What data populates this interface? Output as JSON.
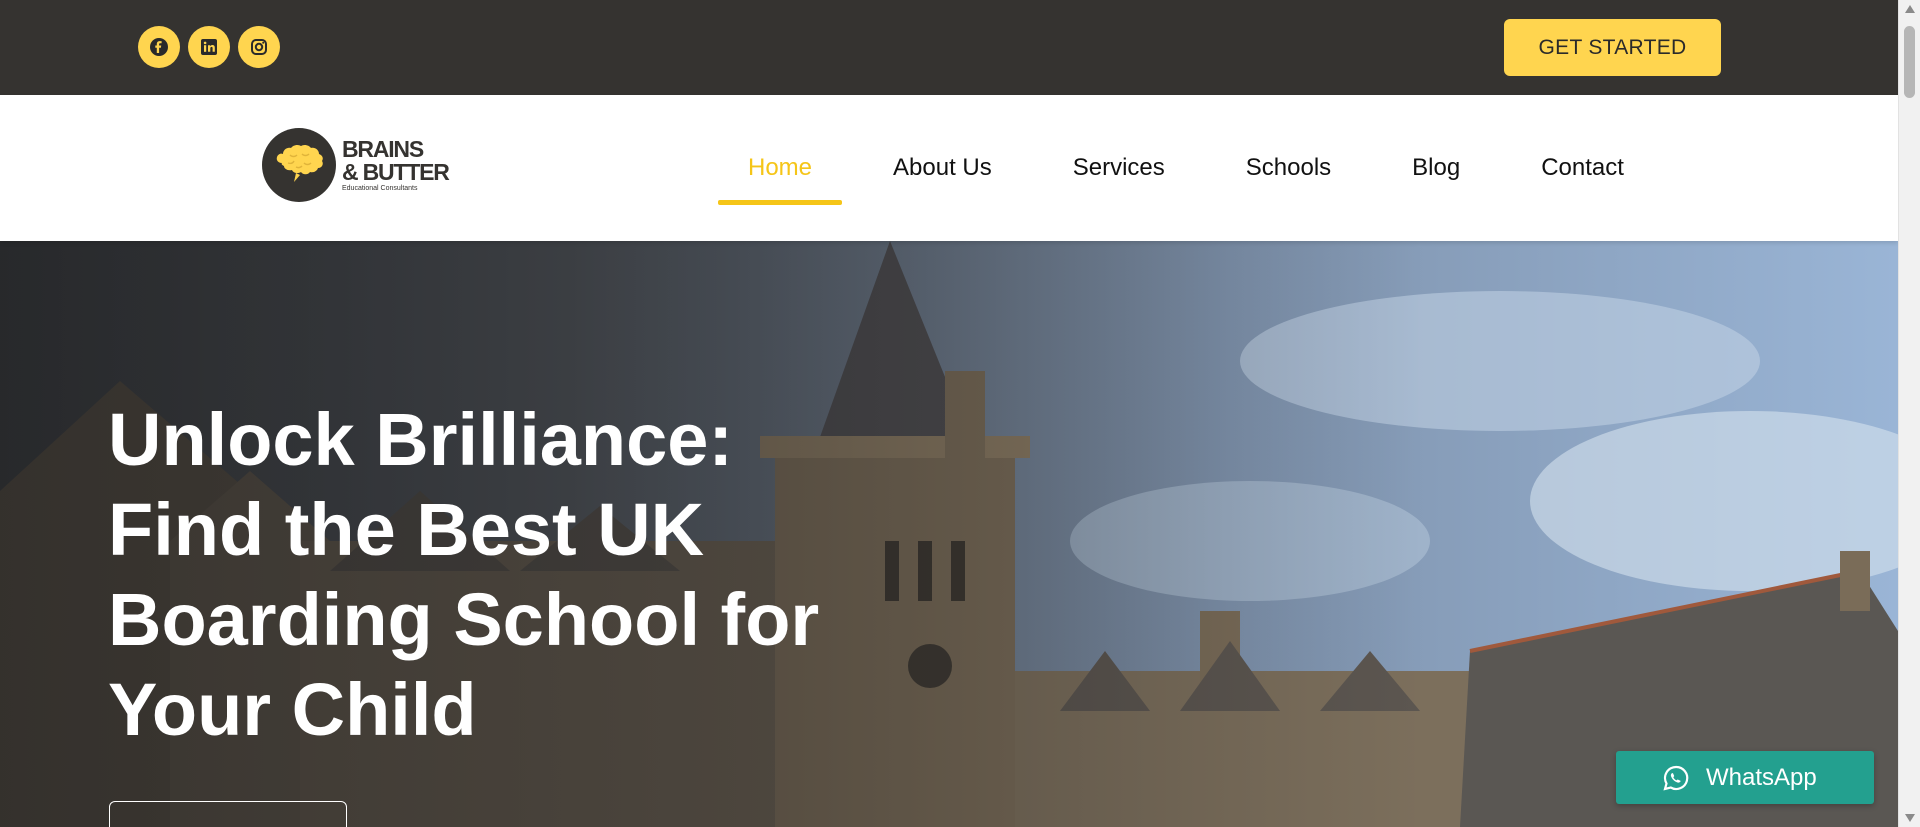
{
  "colors": {
    "topbar_bg": "#353330",
    "accent_yellow": "#ffd54f",
    "nav_active": "#f5c518",
    "whatsapp_green": "#23a08f"
  },
  "topbar": {
    "social_links": [
      {
        "name": "facebook-icon"
      },
      {
        "name": "linkedin-icon"
      },
      {
        "name": "instagram-icon"
      }
    ],
    "cta_label": "GET STARTED"
  },
  "logo": {
    "line1": "BRAINS",
    "line2": "& BUTTER",
    "line3": "Educational Consultants",
    "icon": "brain-icon"
  },
  "nav": {
    "active": "Home",
    "items": [
      "Home",
      "About Us",
      "Services",
      "Schools",
      "Blog",
      "Contact"
    ]
  },
  "hero": {
    "title": "Unlock Brilliance: Find the Best UK Boarding School for Your Child",
    "background": "boarding-school-building-photo"
  },
  "whatsapp": {
    "label": "WhatsApp",
    "icon": "whatsapp-icon"
  }
}
